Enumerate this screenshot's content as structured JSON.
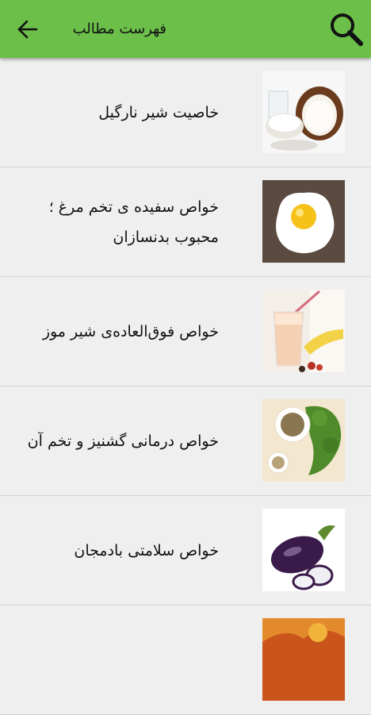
{
  "appbar": {
    "title": "فهرست مطالب",
    "search_icon": "search-icon",
    "back_icon": "arrow-left-icon",
    "color": "#6cc04a"
  },
  "items": [
    {
      "label": "خاصیت شیر نارگیل",
      "image": "coconut-milk"
    },
    {
      "label": "خواص سفیده ی تخم مرغ ؛ محبوب بدنسازان",
      "image": "fried-egg"
    },
    {
      "label": "خواص فوق‌العاده‌ی شیر موز",
      "image": "banana-milkshake"
    },
    {
      "label": "خواص درمانی گشنیز و تخم آن",
      "image": "coriander-seeds"
    },
    {
      "label": "خواص سلامتی بادمجان",
      "image": "eggplant"
    }
  ]
}
